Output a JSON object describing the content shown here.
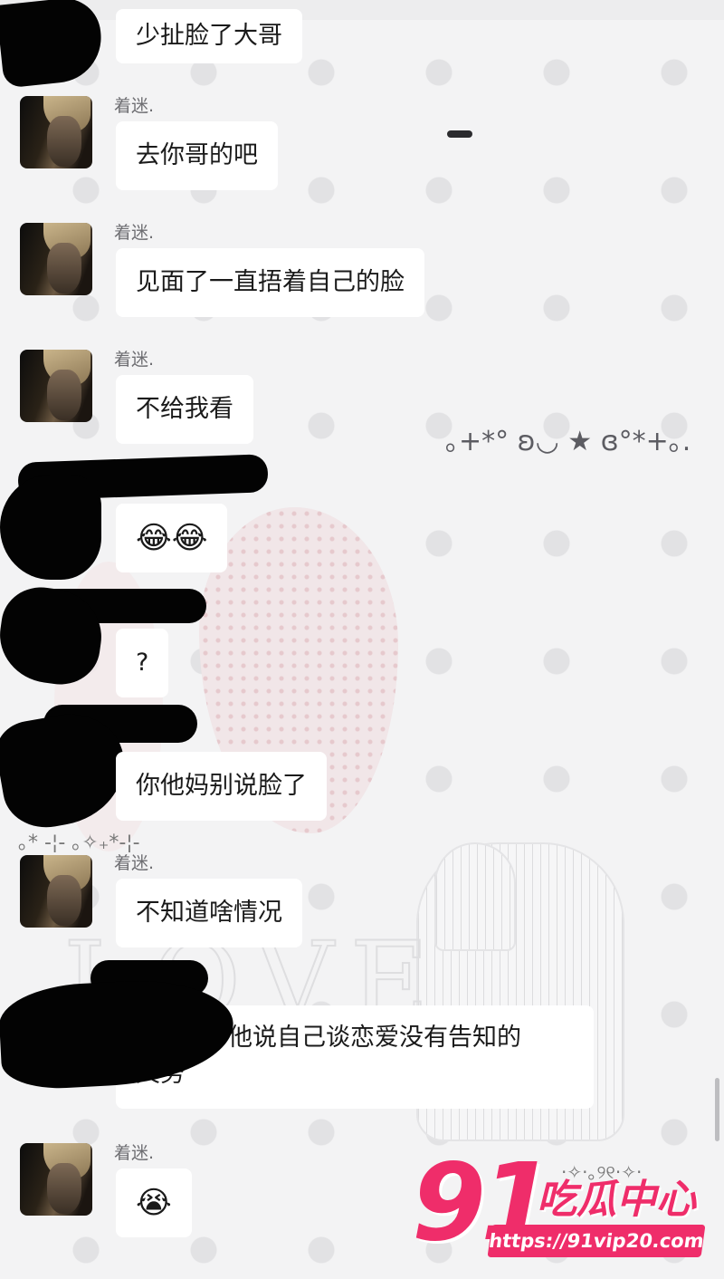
{
  "chat": {
    "partner_name": "着迷.",
    "messages": [
      {
        "text": "少扯脸了大哥"
      },
      {
        "text": "去你哥的吧"
      },
      {
        "text": "见面了一直捂着自己的脸"
      },
      {
        "text": "不给我看"
      },
      {
        "emoji": "😂😂"
      },
      {
        "text": "?"
      },
      {
        "text": "你他妈别说脸了"
      },
      {
        "text": "不知道啥情况"
      },
      {
        "text": "他说自己谈恋爱没有告知的",
        "text2": "义务"
      },
      {
        "emoji": "😭"
      }
    ]
  },
  "decor": {
    "kaomoji": "｡+*° ʚ◡ ★ ɞ°*+｡.",
    "stars_line": "｡*    -¦-  ｡✧₊*-¦-",
    "stars_bottom": "·✧·｡୨୧·✧·"
  },
  "watermark": {
    "logo_number": "91",
    "logo_text": "吃瓜中心",
    "url": "https://91vip20.com",
    "color": "#ef2d6a"
  },
  "icons": {
    "avatar": "anime-character-avatar-icon",
    "cry_laugh": "face-with-tears-of-joy-emoji",
    "crying": "loudly-crying-face-emoji"
  }
}
